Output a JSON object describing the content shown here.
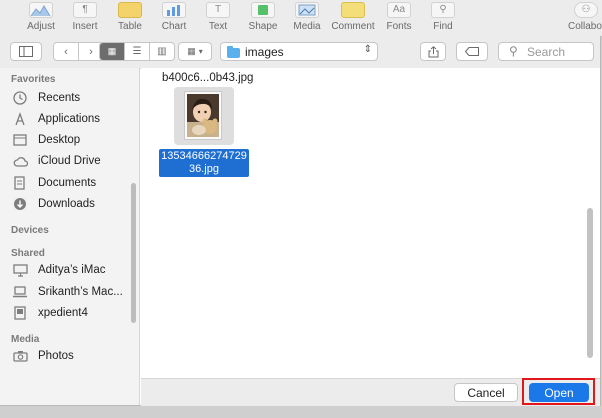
{
  "app_toolbar": {
    "items": [
      {
        "label": "Adjust",
        "icon": "adjust-icon"
      },
      {
        "label": "Insert",
        "icon": "pilcrow-icon"
      },
      {
        "label": "Table",
        "icon": "table-icon"
      },
      {
        "label": "Chart",
        "icon": "chart-icon"
      },
      {
        "label": "Text",
        "icon": "text-icon"
      },
      {
        "label": "Shape",
        "icon": "shape-icon"
      },
      {
        "label": "Media",
        "icon": "media-icon"
      },
      {
        "label": "Comment",
        "icon": "comment-icon"
      },
      {
        "label": "Fonts",
        "icon": "fonts-icon"
      },
      {
        "label": "Find",
        "icon": "search-icon"
      },
      {
        "label": "Collabo",
        "icon": "collaborate-icon"
      }
    ]
  },
  "dialog_toolbar": {
    "location": "images",
    "search_placeholder": "Search"
  },
  "sidebar": {
    "favorites_heading": "Favorites",
    "favorites": [
      {
        "label": "Recents",
        "icon": "clock-icon"
      },
      {
        "label": "Applications",
        "icon": "applications-icon"
      },
      {
        "label": "Desktop",
        "icon": "desktop-icon"
      },
      {
        "label": "iCloud Drive",
        "icon": "cloud-icon"
      },
      {
        "label": "Documents",
        "icon": "documents-icon"
      },
      {
        "label": "Downloads",
        "icon": "download-icon"
      }
    ],
    "devices_heading": "Devices",
    "shared_heading": "Shared",
    "shared": [
      {
        "label": "Aditya’s iMac",
        "icon": "imac-icon"
      },
      {
        "label": "Srikanth’s Mac...",
        "icon": "laptop-icon"
      },
      {
        "label": "xpedient4",
        "icon": "server-icon"
      }
    ],
    "media_heading": "Media",
    "media": [
      {
        "label": "Photos",
        "icon": "camera-icon"
      }
    ]
  },
  "files": {
    "top_filename": "b400c6...0b43.jpg",
    "selected_line1": "13534666274729",
    "selected_line2": "36.jpg"
  },
  "footer": {
    "cancel_label": "Cancel",
    "open_label": "Open"
  },
  "colors": {
    "accent": "#1b78e8",
    "selection": "#1f6fd2",
    "highlight_outline": "#e0171b"
  }
}
